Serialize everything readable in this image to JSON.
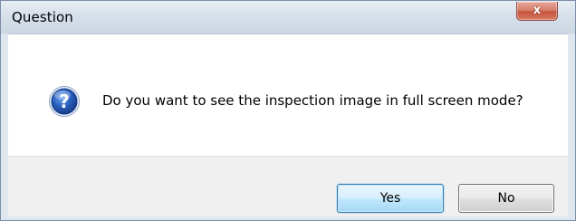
{
  "window": {
    "title": "Question",
    "close_glyph": "x",
    "frame_color": "#dfe6ee",
    "close_color": "#c6543f"
  },
  "dialog": {
    "icon": "question-icon",
    "icon_color": "#1c4fa3",
    "message": "Do you want to see the inspection image in full screen mode?"
  },
  "buttons": {
    "yes_label": "Yes",
    "no_label": "No",
    "default": "Yes"
  }
}
